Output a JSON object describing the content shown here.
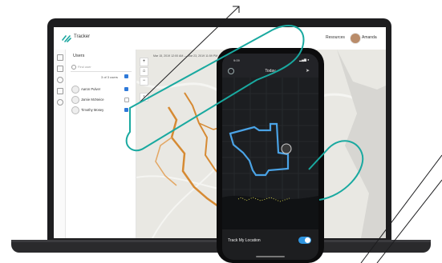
{
  "app": {
    "title": "Tracker",
    "header_resources": "Resources",
    "header_user": "Amanda"
  },
  "panel": {
    "title": "Users",
    "search_placeholder": "Find user",
    "count_text": "3 of 3 users",
    "users": [
      {
        "name": "Aaron Pulver",
        "checked": true
      },
      {
        "name": "Jamie McNeice",
        "checked": false
      },
      {
        "name": "Timothy Mosey",
        "checked": true
      }
    ]
  },
  "map": {
    "date_range": "Mar 15, 2019 12:00 AM — Mar 23, 2019 11:59 PM",
    "controls": [
      "+",
      "⌂",
      "−"
    ],
    "track_color": "#d68a33"
  },
  "phone": {
    "status_time": "9:09",
    "status_icons": "▂▄▆ ●",
    "header_title": "Today",
    "track_label": "Track My Location",
    "toggle_on": true,
    "track_color": "#4aa3e6"
  },
  "colors": {
    "accent": "#2f7ad9",
    "teal": "#19a9a0",
    "laptop": "#1d1d1f"
  }
}
